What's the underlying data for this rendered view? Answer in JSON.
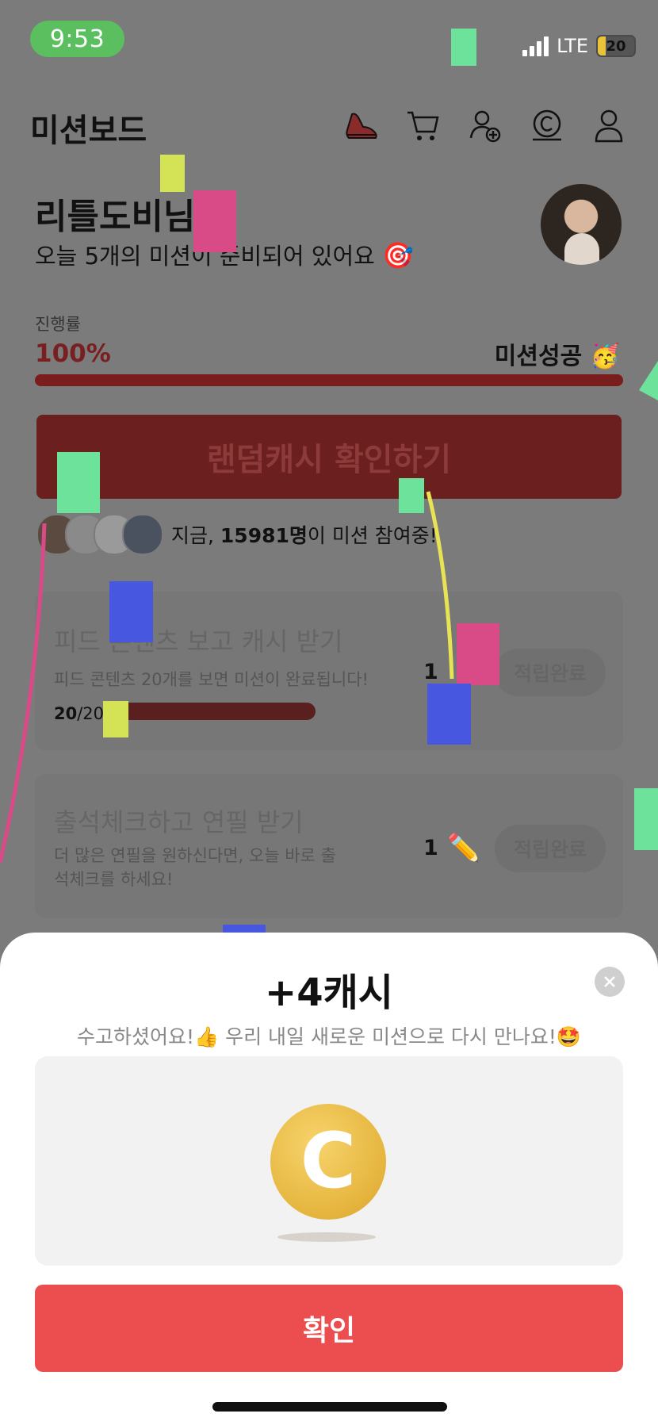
{
  "status_bar": {
    "time": "9:53",
    "network": "LTE",
    "battery": "20"
  },
  "header": {
    "title": "미션보드",
    "icons": [
      "sneaker-icon",
      "cart-icon",
      "add-user-icon",
      "cash-coin-icon",
      "profile-icon"
    ]
  },
  "greeting": {
    "name": "리틀도비님",
    "subtitle": "오늘 5개의 미션이 준비되어 있어요",
    "subtitle_emoji": "🎯"
  },
  "progress": {
    "label": "진행률",
    "value_text": "100%",
    "value": 1.0,
    "status": "미션성공 🥳"
  },
  "random_cash_button": "랜덤캐시 확인하기",
  "participants": {
    "prefix": "지금, ",
    "count": "15981명",
    "suffix": "이 미션 참여중!"
  },
  "missions": [
    {
      "title": "피드 콘텐츠 보고 캐시 받기",
      "desc": "피드 콘텐츠 20개를 보면 미션이 완료됩니다!",
      "count_done": "20",
      "count_total": "/20",
      "reward": "1",
      "button": "적립완료"
    },
    {
      "title": "출석체크하고 연필 받기",
      "desc": "더 많은 연필을 원하신다면, 오늘 바로 출석체크를 하세요!",
      "reward": "1",
      "reward_icon": "✏️",
      "button": "적립완료"
    }
  ],
  "sheet": {
    "title": "+4캐시",
    "subtitle": "수고하셨어요!👍 우리 내일 새로운 미션으로 다시 만나요!🤩",
    "coin_letter": "C",
    "confirm": "확인"
  },
  "colors": {
    "overlay_gray": "#7b7b7b",
    "accent_red": "#ec4d4f",
    "coin_gold": "#e5b43d",
    "time_green": "#5cbf5f"
  }
}
